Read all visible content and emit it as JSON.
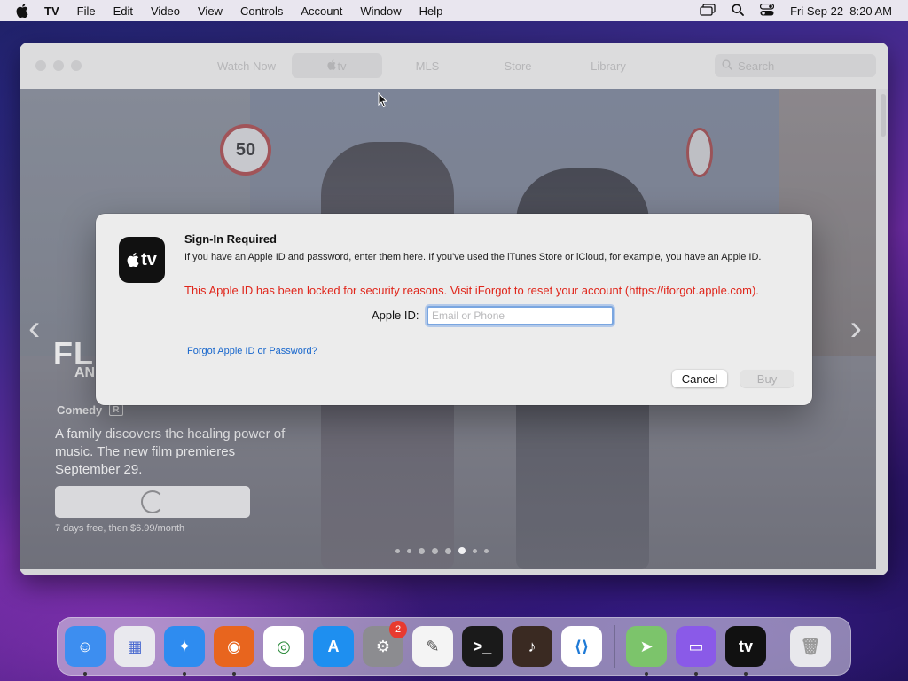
{
  "menubar": {
    "app_name": "TV",
    "items": [
      "File",
      "Edit",
      "Video",
      "View",
      "Controls",
      "Account",
      "Window",
      "Help"
    ],
    "datetime": "Fri Sep 22  8:20 AM"
  },
  "window": {
    "tabs": [
      "Watch Now",
      "tv",
      "MLS",
      "Store",
      "Library"
    ],
    "active_tab_index": 1,
    "search_placeholder": "Search"
  },
  "hero": {
    "title_partial": "FL",
    "title_sub_partial": "AN",
    "genre": "Comedy",
    "rating": "R",
    "description": "A family discovers the healing power of music. The new film premieres September 29.",
    "price_note": "7 days free, then $6.99/month",
    "page_dots_count": 8,
    "page_dots_active_index": 5
  },
  "dialog": {
    "title": "Sign-In Required",
    "body": "If you have an Apple ID and password, enter them here. If you've used the iTunes Store or iCloud, for example, you have an Apple ID.",
    "error": "This Apple ID has been locked for security reasons. Visit iForgot to reset your account (https://iforgot.apple.com).",
    "apple_id_label": "Apple ID:",
    "apple_id_placeholder": "Email or Phone",
    "apple_id_value": "",
    "forgot_link": "Forgot Apple ID or Password?",
    "cancel_label": "Cancel",
    "buy_label": "Buy",
    "app_icon_text": "tv"
  },
  "dock": {
    "apps": [
      {
        "name": "Finder",
        "icon": "finder-icon",
        "color": "#3d8ef0",
        "running": true
      },
      {
        "name": "Launchpad",
        "icon": "launchpad-icon",
        "color": "#e9e9ee",
        "running": false
      },
      {
        "name": "Safari",
        "icon": "safari-icon",
        "color": "#2e8cf0",
        "running": true
      },
      {
        "name": "Firefox",
        "icon": "firefox-icon",
        "color": "#e8651e",
        "running": true
      },
      {
        "name": "Chrome",
        "icon": "chrome-icon",
        "color": "#ffffff",
        "running": false
      },
      {
        "name": "App Store",
        "icon": "app-store-icon",
        "color": "#1e8ff0",
        "running": false
      },
      {
        "name": "System Settings",
        "icon": "system-settings-icon",
        "color": "#8c8c90",
        "running": false,
        "badge": "2"
      },
      {
        "name": "TextEdit",
        "icon": "textedit-icon",
        "color": "#f4f4f4",
        "running": false
      },
      {
        "name": "Terminal",
        "icon": "terminal-icon",
        "color": "#1a1a1a",
        "running": false
      },
      {
        "name": "GarageBand",
        "icon": "garageband-icon",
        "color": "#3a2a22",
        "running": false
      },
      {
        "name": "VS Code",
        "icon": "vscode-icon",
        "color": "#ffffff",
        "running": false
      },
      {
        "name": "Maps",
        "icon": "maps-icon",
        "color": "#7cc46b",
        "running": true
      },
      {
        "name": "Simulator",
        "icon": "simulator-icon",
        "color": "#8a5ae8",
        "running": true
      },
      {
        "name": "TV",
        "icon": "tv-icon",
        "color": "#111111",
        "running": true
      },
      {
        "name": "Trash",
        "icon": "trash-icon",
        "color": "#e8e8ec",
        "running": false
      }
    ]
  }
}
